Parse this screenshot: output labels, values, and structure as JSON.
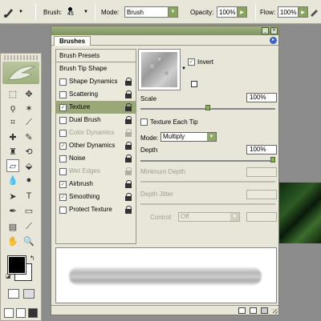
{
  "options_bar": {
    "brush_label": "Brush:",
    "brush_size": "45",
    "mode_label": "Mode:",
    "mode_value": "Brush",
    "opacity_label": "Opacity:",
    "opacity_value": "100%",
    "flow_label": "Flow:",
    "flow_value": "100%"
  },
  "palette": {
    "tab": "Brushes",
    "left_list": {
      "header": "Brush Presets",
      "items": [
        {
          "label": "Brush Tip Shape",
          "checkbox": false,
          "checked": false,
          "lock": false,
          "selected": false,
          "disabled": false
        },
        {
          "label": "Shape Dynamics",
          "checkbox": true,
          "checked": false,
          "lock": true,
          "selected": false,
          "disabled": false
        },
        {
          "label": "Scattering",
          "checkbox": true,
          "checked": false,
          "lock": true,
          "selected": false,
          "disabled": false
        },
        {
          "label": "Texture",
          "checkbox": true,
          "checked": true,
          "lock": true,
          "selected": true,
          "disabled": false
        },
        {
          "label": "Dual Brush",
          "checkbox": true,
          "checked": false,
          "lock": true,
          "selected": false,
          "disabled": false
        },
        {
          "label": "Color Dynamics",
          "checkbox": true,
          "checked": false,
          "lock": true,
          "selected": false,
          "disabled": true
        },
        {
          "label": "Other Dynamics",
          "checkbox": true,
          "checked": true,
          "lock": true,
          "selected": false,
          "disabled": false
        },
        {
          "label": "Noise",
          "checkbox": true,
          "checked": false,
          "lock": true,
          "selected": false,
          "disabled": false
        },
        {
          "label": "Wet Edges",
          "checkbox": true,
          "checked": false,
          "lock": true,
          "selected": false,
          "disabled": true
        },
        {
          "label": "Airbrush",
          "checkbox": true,
          "checked": true,
          "lock": true,
          "selected": false,
          "disabled": false
        },
        {
          "label": "Smoothing",
          "checkbox": true,
          "checked": true,
          "lock": true,
          "selected": false,
          "disabled": false
        },
        {
          "label": "Protect Texture",
          "checkbox": true,
          "checked": false,
          "lock": true,
          "selected": false,
          "disabled": false
        }
      ]
    },
    "texture": {
      "invert_label": "Invert",
      "invert_checked": true,
      "scale_label": "Scale",
      "scale_value": "100%",
      "scale_fraction": 0.5,
      "texture_each_tip_label": "Texture Each Tip",
      "texture_each_tip_checked": false,
      "mode_label": "Mode:",
      "mode_value": "Multiply",
      "depth_label": "Depth",
      "depth_value": "100%",
      "depth_fraction": 1.0,
      "min_depth_label": "Minimum Depth",
      "depth_jitter_label": "Depth Jitter",
      "control_label": "Control:",
      "control_value": "Off"
    }
  },
  "colors": {
    "accent_green": "#8aa35f",
    "panel_bg": "#e8e6d8",
    "selection": "#9aa878",
    "foreground": "#000000",
    "background": "#ffffff"
  }
}
